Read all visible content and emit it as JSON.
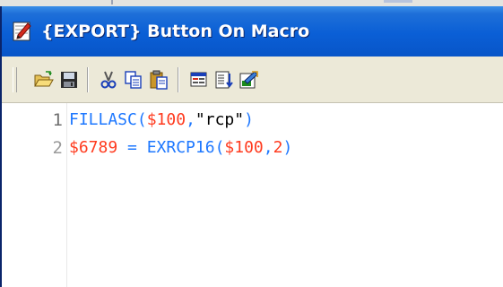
{
  "window": {
    "title": "{EXPORT} Button On Macro",
    "title_icon": "edit-document-icon"
  },
  "toolbar": {
    "buttons": [
      {
        "name": "open-folder-button",
        "icon": "open-folder-icon"
      },
      {
        "name": "save-button",
        "icon": "floppy-disk-icon"
      },
      {
        "name": "cut-button",
        "icon": "scissors-icon"
      },
      {
        "name": "copy-button",
        "icon": "copy-icon"
      },
      {
        "name": "paste-button",
        "icon": "clipboard-paste-icon"
      },
      {
        "name": "insert-command-button",
        "icon": "window-list-icon"
      },
      {
        "name": "list-button",
        "icon": "list-arrow-icon"
      },
      {
        "name": "compile-button",
        "icon": "document-arrow-icon"
      }
    ]
  },
  "editor": {
    "line_numbers": [
      "1",
      "2"
    ],
    "lines": [
      {
        "tokens": [
          {
            "text": "FILLASC",
            "kind": "keyword"
          },
          {
            "text": "(",
            "kind": "punct"
          },
          {
            "text": "$100",
            "kind": "number"
          },
          {
            "text": ",",
            "kind": "punct"
          },
          {
            "text": "\"rcp\"",
            "kind": "string"
          },
          {
            "text": ")",
            "kind": "punct"
          }
        ]
      },
      {
        "tokens": [
          {
            "text": "$6789",
            "kind": "number"
          },
          {
            "text": " = ",
            "kind": "punct"
          },
          {
            "text": "EXRCP16",
            "kind": "keyword"
          },
          {
            "text": "(",
            "kind": "punct"
          },
          {
            "text": "$100",
            "kind": "number"
          },
          {
            "text": ",",
            "kind": "punct"
          },
          {
            "text": "2",
            "kind": "number"
          },
          {
            "text": ")",
            "kind": "punct"
          }
        ]
      }
    ]
  },
  "colors": {
    "titlebar": "#0a5fd6",
    "toolbar": "#ece9d8",
    "keyword": "#1e78ff",
    "number": "#ff3b1f",
    "string": "#000000",
    "line_number": "#6f6f6f"
  }
}
